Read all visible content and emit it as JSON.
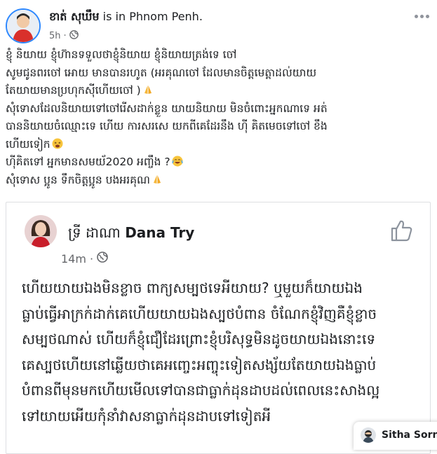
{
  "post": {
    "author": "ខាត់ សុឃឹម",
    "location_text": " is in Phnom Penh.",
    "time": "5h",
    "privacy_icon": "globe-icon",
    "body_lines": [
      "ខ្ញុំ និយាយ ខ្ញុំហ៊ានទទួលថាខ្ញុំនិយាយ ខ្ញុំនិយាយត្រង់ទេ ចៅ",
      "សូមជូនពរចៅ អោយ មានបានរហូត (អរគុណចៅ ដែលមានចិត្តមេត្តាដល់យាយ",
      "តែយាយមានប្រហុកស៊ីហើយចៅ )",
      "សុំទោសដែលនិយាយទៅចៅរើសដាក់ខ្លួន យាយនិយាយ មិនចំពោះអ្នកណាទេ អត់",
      "បាននិយាយចំឈ្មោះទេ ហើយ ការសរសេ យកពីគេដែរនឹង ហ៊ី គិតមេចទៅចៅ ខឹង",
      "ហើយទៀក",
      "ហ៊ីគិតទៅ អ្នកមានសមយ័2020 អញ្ចឹង ?",
      "សុំទោស ប្អូន ទឹកចិត្តប្អូន បងអរគុណ"
    ],
    "line_emojis": [
      "",
      "",
      "folded-hands",
      "",
      "",
      "tired-face",
      "joy-face",
      "folded-hands"
    ]
  },
  "shared": {
    "author_khmer": "ទ្រី ដាណា",
    "author_latin": "Dana Try",
    "time": "14m",
    "like_icon": "thumbs-up-icon",
    "text_lines": [
      "ហើយយាយឯងមិនខ្លាច ពាក្យសម្បថទេអីយាយ? ឬមួយក៏យាយឯង",
      "ធ្លាប់ធ្វើអាក្រក់ដាក់គេហើយយាយឯងស្បថបំពាន ចំណែកខ្ញុំវិញគឺខ្ញុំខ្លាច",
      "សម្បថណាស់ ហើយក៏ខ្ញុំជឿដែរព្រោះខ្ញុំបរិសុទ្ធមិនដូចយាយឯងនោះទេ",
      "គេស្បថហើយនៅឆ្លើយថាគេអញ្ចេះអញ្ចុះទៀតសង្ស័យតែយាយឯងធ្លាប់",
      "បំពានពីមុនមកហើយមើលទៅបានជាធ្លាក់ដុនដាបដល់ពេលនេះសាងល្អ",
      "ទៅយាយអើយកុំនាំវាសនាធ្លាក់ដុនដាបទៅទៀតអី"
    ]
  },
  "chat": {
    "name": "Sitha Sorn"
  },
  "colors": {
    "avatar_ring": "#2d88ff",
    "meta_text": "#65676b",
    "border": "#dddfe2"
  }
}
